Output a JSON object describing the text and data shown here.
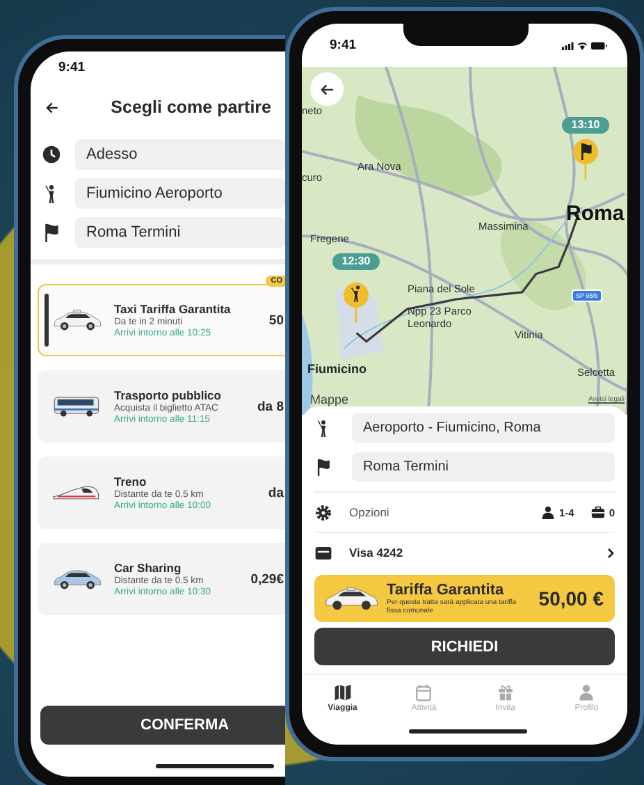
{
  "left_phone": {
    "status_time": "9:41",
    "title": "Scegli come partire",
    "fields": [
      {
        "kind": "clock",
        "value": "Adesso"
      },
      {
        "kind": "pickup",
        "value": "Fiumicino Aeroporto"
      },
      {
        "kind": "flag",
        "value": "Roma Termini"
      }
    ],
    "options": [
      {
        "kind": "taxi",
        "name": "Taxi Tariffa Garantita",
        "detail": "Da te in 2 minuti",
        "arrival": "Arrivi intorno alle 10:25",
        "price": "50",
        "badge": "CO",
        "selected": true
      },
      {
        "kind": "bus",
        "name": "Trasporto pubblico",
        "detail": "Acquista il biglietto ATAC",
        "arrival": "Arrivi intorno alle 11:15",
        "price": "da 8",
        "selected": false
      },
      {
        "kind": "train",
        "name": "Treno",
        "detail": "Distante da te 0.5 km",
        "arrival": "Arrivi intorno alle 10:00",
        "price": "da",
        "selected": false
      },
      {
        "kind": "car",
        "name": "Car Sharing",
        "detail": "Distante da te 0.5 km",
        "arrival": "Arrivi intorno alle 10:30",
        "price": "0,29€",
        "selected": false
      }
    ],
    "confirm_button": "CONFERMA"
  },
  "right_phone": {
    "status_time": "9:41",
    "map": {
      "labels": [
        {
          "kind": "town",
          "text": "neto"
        },
        {
          "kind": "town",
          "text": "Ara Nova"
        },
        {
          "kind": "town",
          "text": "curo"
        },
        {
          "kind": "city",
          "text": "Roma"
        },
        {
          "kind": "town",
          "text": "Massimina"
        },
        {
          "kind": "town",
          "text": "Fregene"
        },
        {
          "kind": "town",
          "text": "Piana del Sole"
        },
        {
          "kind": "town",
          "text": "Npp 23 Parco"
        },
        {
          "kind": "town",
          "text": "Leonardo"
        },
        {
          "kind": "town",
          "text": "Vitinia"
        },
        {
          "kind": "area",
          "text": "Fiumicino"
        },
        {
          "kind": "town",
          "text": "Selcetta"
        }
      ],
      "pins": [
        {
          "kind": "pickup",
          "time": "12:30"
        },
        {
          "kind": "flag",
          "time": "13:10"
        }
      ],
      "road_sign": "SP 95/b",
      "attribution": "Mappe",
      "legal": "Avvisi legali"
    },
    "fields": [
      {
        "kind": "pickup",
        "value": "Aeroporto - Fiumicino, Roma"
      },
      {
        "kind": "flag",
        "value": "Roma Termini"
      }
    ],
    "options_label": "Opzioni",
    "passengers": "1-4",
    "luggage": "0",
    "payment": "Visa 4242",
    "fare": {
      "title": "Tariffa Garantita",
      "note": "Per questa tratta sarà applicata una tariffa fissa comunale",
      "price": "50,00 €"
    },
    "request_button": "RICHIEDI",
    "tabs": [
      {
        "kind": "map",
        "label": "Viaggia",
        "selected": true
      },
      {
        "kind": "calendar",
        "label": "Attività",
        "selected": false
      },
      {
        "kind": "gift",
        "label": "Invita",
        "selected": false
      },
      {
        "kind": "person",
        "label": "Profilo",
        "selected": false
      }
    ]
  }
}
